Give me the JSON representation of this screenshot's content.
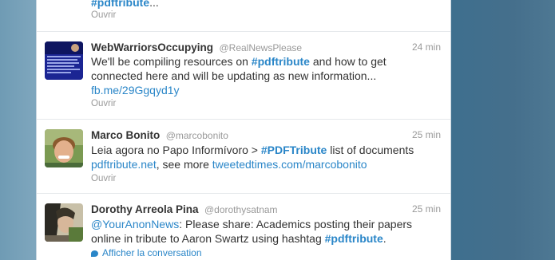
{
  "prev_tweet": {
    "tail_hashtag": "#pdftribute",
    "tail_suffix": "...",
    "action": "Ouvrir"
  },
  "tweets": [
    {
      "name": "WebWarriorsOccupying",
      "handle": "@RealNewsPlease",
      "time": "24 min",
      "line1_a": "We'll be compiling resources on ",
      "line1_hash": "#pdftribute",
      "line1_b": " and how to get",
      "line2": "connected here and will be updating as new information...",
      "line3_link": "fb.me/29Ggqyd1y",
      "action": "Ouvrir"
    },
    {
      "name": "Marco Bonito",
      "handle": "@marcobonito",
      "time": "25 min",
      "line1_a": "Leia agora no Papo Informívoro > ",
      "line1_hash": "#PDFTribute",
      "line1_b": " list of documents",
      "line2_link1": "pdftribute.net",
      "line2_mid": ", see more ",
      "line2_link2": "tweetedtimes.com/marcobonito",
      "action": "Ouvrir"
    },
    {
      "name": "Dorothy Arreola Pina",
      "handle": "@dorothysatnam",
      "time": "25 min",
      "line1_mention": "@YourAnonNews",
      "line1_rest": ": Please share: Academics posting their papers",
      "line2_a": "online in tribute to Aaron Swartz using hashtag ",
      "line2_hash": "#pdftribute",
      "line2_b": ".",
      "action": "Afficher la conversation"
    }
  ]
}
